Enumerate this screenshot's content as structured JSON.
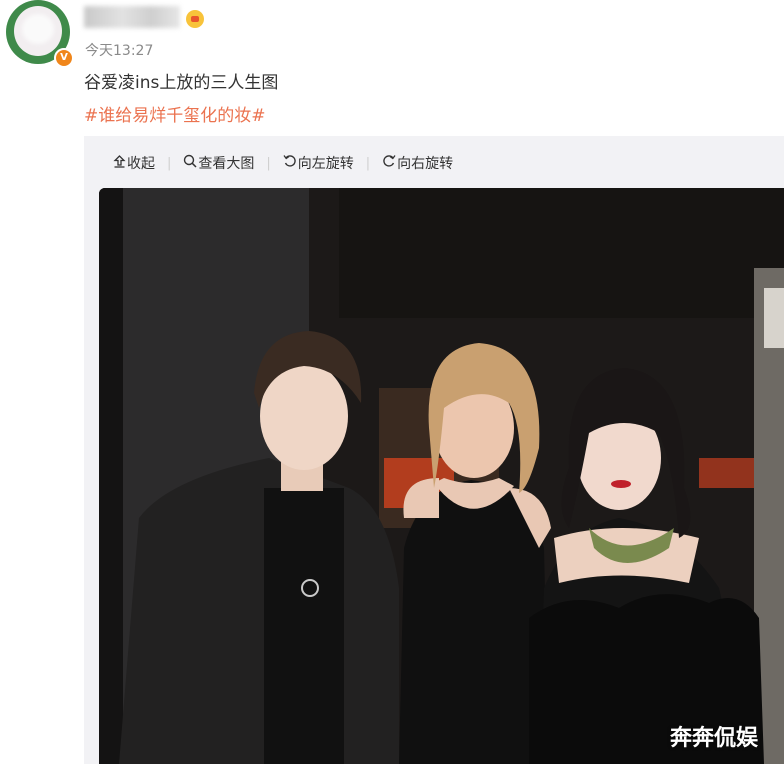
{
  "post": {
    "time": "今天13:27",
    "text": "谷爱凌ins上放的三人生图",
    "hashtag": "#谁给易烊千玺化的妆#",
    "verified_badge": "V"
  },
  "toolbar": {
    "collapse_label": "收起",
    "view_large_label": "查看大图",
    "rotate_left_label": "向左旋转",
    "rotate_right_label": "向右旋转",
    "icons": [
      "collapse-arrow-icon",
      "magnifier-icon",
      "rotate-left-icon",
      "rotate-right-icon"
    ]
  },
  "photo": {
    "watermark": "奔奔侃娱"
  },
  "colors": {
    "hashtag": "#eb7350",
    "card_bg": "#f2f2f5",
    "avatar_ring": "#3f8a4a",
    "badge": "#f0861b"
  }
}
